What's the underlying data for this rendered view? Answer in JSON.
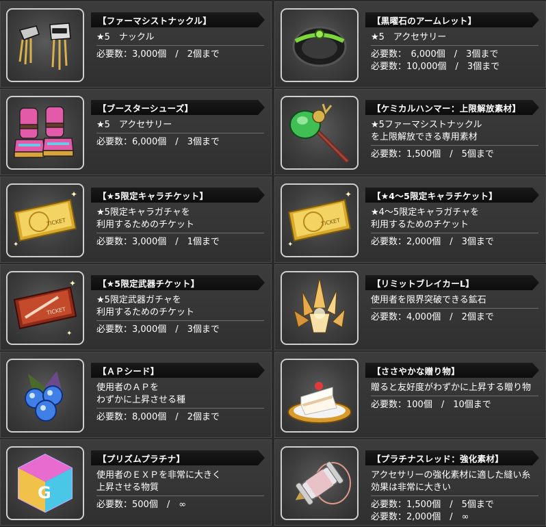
{
  "items": [
    {
      "id": "farmacist",
      "title": "【ファーマシストナックル】",
      "desc": [
        "★5　ナックル"
      ],
      "reqs": [
        "必要数：3,000個　/　2個まで"
      ],
      "icon": "knuckle-icon"
    },
    {
      "id": "armlet",
      "title": "【黒曜石のアームレット】",
      "desc": [
        "★5　アクセサリー"
      ],
      "reqs": [
        "必要数：　6,000個　/　3個まで",
        "必要数：10,000個　/　3個まで"
      ],
      "icon": "armlet-icon"
    },
    {
      "id": "booster",
      "title": "【ブースターシューズ】",
      "desc": [
        "★5　アクセサリー"
      ],
      "reqs": [
        "必要数：6,000個　/　3個まで"
      ],
      "icon": "shoes-icon"
    },
    {
      "id": "hammer",
      "title": "【ケミカルハンマー：上限解放素材】",
      "desc": [
        "★5ファーマシストナックル",
        "を上限解放できる専用素材"
      ],
      "reqs": [
        "必要数：1,500個　/　5個まで"
      ],
      "icon": "hammer-icon"
    },
    {
      "id": "ticket5",
      "title": "【★5限定キャラチケット】",
      "desc": [
        "★5限定キャラガチャを",
        "利用するためのチケット"
      ],
      "reqs": [
        "必要数：3,000個　/　1個まで"
      ],
      "icon": "gold-ticket-icon"
    },
    {
      "id": "ticket45",
      "title": "【★4～5限定キャラチケット】",
      "desc": [
        "★4～5限定キャラガチャを",
        "利用するためのチケット"
      ],
      "reqs": [
        "必要数：2,000個　/　3個まで"
      ],
      "icon": "gold-ticket-icon"
    },
    {
      "id": "weaponticket",
      "title": "【★5限定武器チケット】",
      "desc": [
        "★5限定武器ガチャを",
        "利用するためのチケット"
      ],
      "reqs": [
        "必要数：3,000個　/　3個まで"
      ],
      "icon": "red-ticket-icon"
    },
    {
      "id": "limitbreak",
      "title": "【リミットブレイカーL】",
      "desc": [
        "使用者を限界突破できる鉱石"
      ],
      "reqs": [
        "必要数：4,000個　/　2個まで"
      ],
      "icon": "crystal-icon"
    },
    {
      "id": "apseed",
      "title": "【ＡＰシード】",
      "desc": [
        "使用者のＡＰを",
        "わずかに上昇させる種"
      ],
      "reqs": [
        "必要数：8,000個　/　2個まで"
      ],
      "icon": "berries-icon"
    },
    {
      "id": "gift",
      "title": "【ささやかな贈り物】",
      "desc": [
        "贈ると友好度がわずかに上昇する贈り物"
      ],
      "reqs": [
        "必要数：100個　/　10個まで"
      ],
      "icon": "cake-icon"
    },
    {
      "id": "prism",
      "title": "【プリズムプラチナ】",
      "desc": [
        "使用者のＥＸＰを非常に大きく",
        "上昇させる物質"
      ],
      "reqs": [
        "必要数：500個　/　∞"
      ],
      "icon": "prism-cube-icon"
    },
    {
      "id": "thread",
      "title": "【プラチナスレッド：強化素材】",
      "desc": [
        "アクセサリーの強化素材に適した縫い糸",
        "効果は非常に大きい"
      ],
      "reqs": [
        "必要数：1,500個　/　5個まで",
        "必要数：2,000個　/　∞"
      ],
      "icon": "thread-spool-icon"
    }
  ]
}
